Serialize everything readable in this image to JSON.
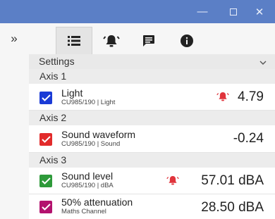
{
  "window": {
    "minimize_glyph": "—",
    "maximize_glyph": "☐",
    "close_glyph": "✕"
  },
  "toolbar": {
    "collapse_glyph": "»",
    "tabs": [
      {
        "icon": "list-icon",
        "active": true
      },
      {
        "icon": "alarm-bell-icon",
        "active": false
      },
      {
        "icon": "message-icon",
        "active": false
      },
      {
        "icon": "info-icon",
        "active": false
      }
    ]
  },
  "settings": {
    "label": "Settings",
    "chevron": "⌵"
  },
  "axes": [
    {
      "title": "Axis 1",
      "channels": [
        {
          "name": "Light",
          "source": "CU985/190 | Light",
          "value": "4.79",
          "checked": true,
          "color": "#1a3bd6",
          "alarm": true
        }
      ]
    },
    {
      "title": "Axis 2",
      "channels": [
        {
          "name": "Sound waveform",
          "source": "CU985/190 | Sound",
          "value": "-0.24",
          "checked": true,
          "color": "#e22b2b",
          "alarm": false
        }
      ]
    },
    {
      "title": "Axis 3",
      "channels": [
        {
          "name": "Sound level",
          "source": "CU985/190 | dBA",
          "value": "57.01 dBA",
          "checked": true,
          "color": "#2e9a3a",
          "alarm": true
        },
        {
          "name": "50% attenuation",
          "source": "Maths Channel",
          "value": "28.50 dBA",
          "checked": true,
          "color": "#b3126e",
          "alarm": false
        }
      ]
    }
  ],
  "colors": {
    "titlebar": "#5b7fc6",
    "alarm": "#e0343c"
  }
}
